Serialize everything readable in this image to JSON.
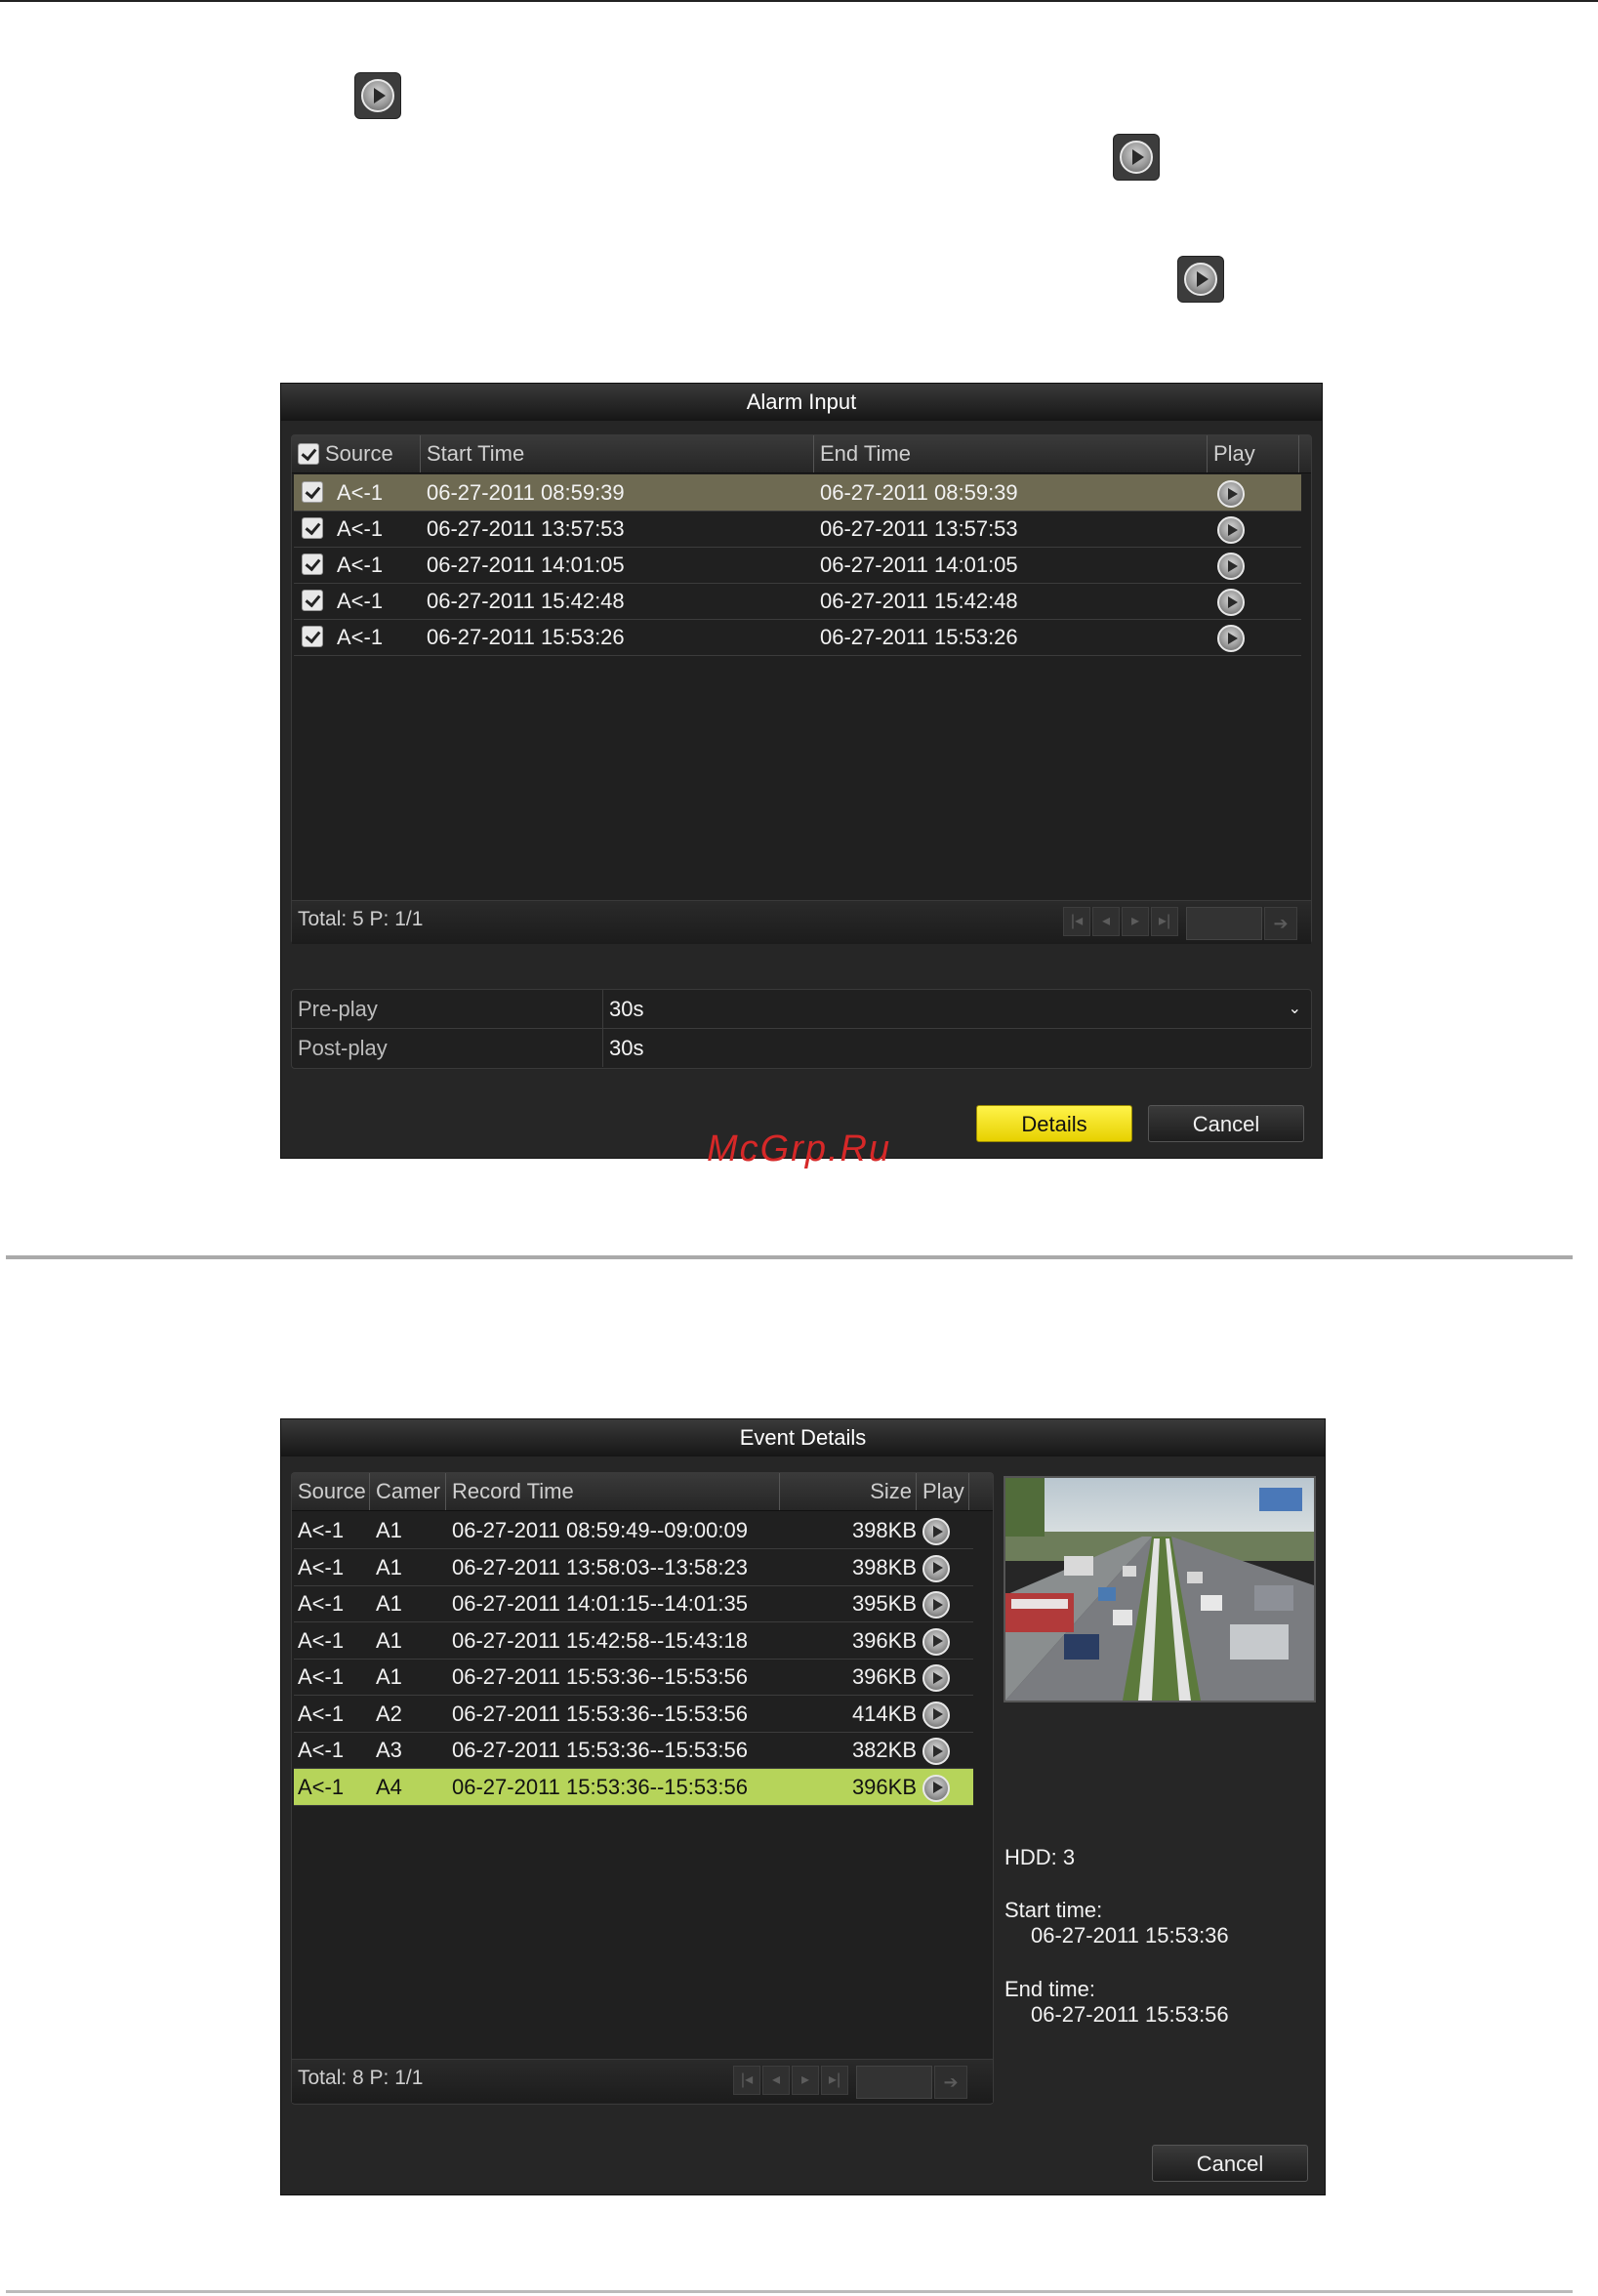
{
  "watermark": "McGrp.Ru",
  "alarm_dialog": {
    "title": "Alarm Input",
    "columns": [
      "Source",
      "Start Time",
      "End Time",
      "Play"
    ],
    "rows": [
      {
        "source": "A<-1",
        "start": "06-27-2011 08:59:39",
        "end": "06-27-2011 08:59:39"
      },
      {
        "source": "A<-1",
        "start": "06-27-2011 13:57:53",
        "end": "06-27-2011 13:57:53"
      },
      {
        "source": "A<-1",
        "start": "06-27-2011 14:01:05",
        "end": "06-27-2011 14:01:05"
      },
      {
        "source": "A<-1",
        "start": "06-27-2011 15:42:48",
        "end": "06-27-2011 15:42:48"
      },
      {
        "source": "A<-1",
        "start": "06-27-2011 15:53:26",
        "end": "06-27-2011 15:53:26"
      }
    ],
    "total": "Total: 5  P: 1/1",
    "preplay_label": "Pre-play",
    "preplay_value": "30s",
    "postplay_label": "Post-play",
    "postplay_value": "30s",
    "details_label": "Details",
    "cancel_label": "Cancel"
  },
  "event_dialog": {
    "title": "Event Details",
    "columns": [
      "Source",
      "Camer",
      "Record Time",
      "Size",
      "Play"
    ],
    "rows": [
      {
        "source": "A<-1",
        "camera": "A1",
        "time": "06-27-2011 08:59:49--09:00:09",
        "size": "398KB"
      },
      {
        "source": "A<-1",
        "camera": "A1",
        "time": "06-27-2011 13:58:03--13:58:23",
        "size": "398KB"
      },
      {
        "source": "A<-1",
        "camera": "A1",
        "time": "06-27-2011 14:01:15--14:01:35",
        "size": "395KB"
      },
      {
        "source": "A<-1",
        "camera": "A1",
        "time": "06-27-2011 15:42:58--15:43:18",
        "size": "396KB"
      },
      {
        "source": "A<-1",
        "camera": "A1",
        "time": "06-27-2011 15:53:36--15:53:56",
        "size": "396KB"
      },
      {
        "source": "A<-1",
        "camera": "A2",
        "time": "06-27-2011 15:53:36--15:53:56",
        "size": "414KB"
      },
      {
        "source": "A<-1",
        "camera": "A3",
        "time": "06-27-2011 15:53:36--15:53:56",
        "size": "382KB"
      },
      {
        "source": "A<-1",
        "camera": "A4",
        "time": "06-27-2011 15:53:36--15:53:56",
        "size": "396KB"
      }
    ],
    "total": "Total: 8  P: 1/1",
    "hdd": "HDD: 3",
    "start_label": "Start time:",
    "start_value": "06-27-2011 15:53:36",
    "end_label": "End time:",
    "end_value": "06-27-2011 15:53:56",
    "cancel_label": "Cancel"
  }
}
